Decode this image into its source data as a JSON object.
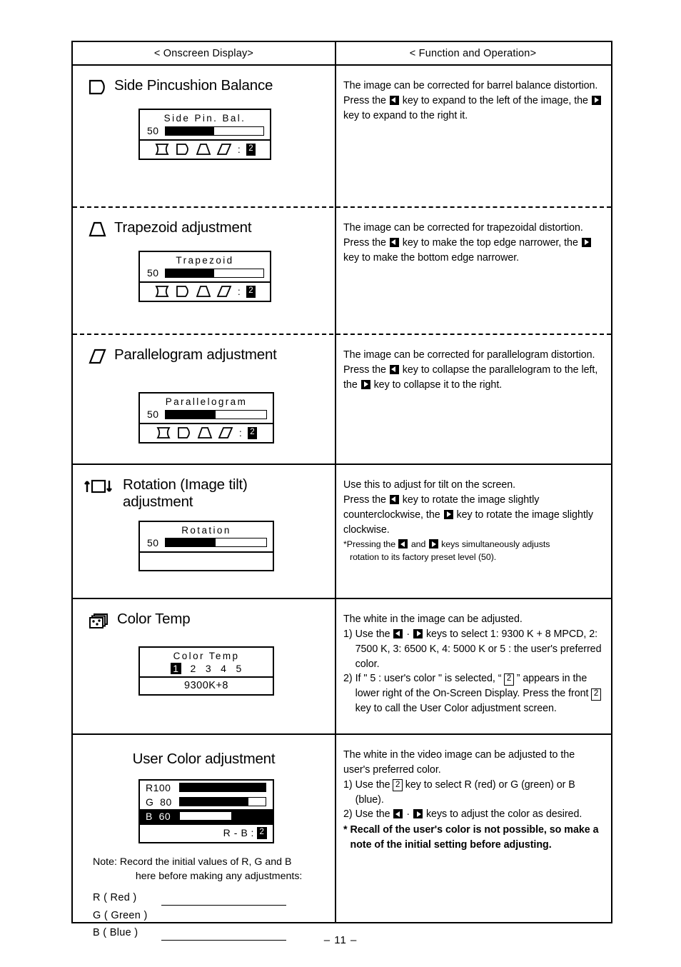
{
  "page": {
    "number_label": "– 11 –"
  },
  "table": {
    "headers": {
      "left": "< Onscreen Display>",
      "right": "< Function and Operation>"
    }
  },
  "sections": [
    {
      "id": "side-pincushion-balance",
      "icon": "side-pincushion-balance-icon",
      "title": "Side Pincushion Balance",
      "osd": {
        "label": "Side Pin. Bal.",
        "value": "50",
        "bar_fill_percent": 50,
        "shapes": [
          "pincushion-shape",
          "side-pin-balance-shape",
          "trapezoid-shape",
          "parallelogram-shape"
        ],
        "colon": ":",
        "key": "2"
      },
      "body": [
        "The image can be corrected for barrel balance distortion. Press the [LEFT] key to expand to the left of the image, the [RIGHT] key to expand to the right it."
      ]
    },
    {
      "id": "trapezoid-adjustment",
      "icon": "trapezoid-icon",
      "title": "Trapezoid  adjustment",
      "osd": {
        "label": "Trapezoid",
        "value": "50",
        "bar_fill_percent": 50,
        "shapes": [
          "pincushion-shape",
          "side-pin-balance-shape",
          "trapezoid-shape",
          "parallelogram-shape"
        ],
        "colon": ":",
        "key": "2"
      },
      "body": [
        "The image can be corrected for trapezoidal distortion.",
        "Press the [LEFT] key to make the top edge narrower, the [RIGHT] key to make the bottom edge narrower."
      ]
    },
    {
      "id": "parallelogram-adjustment",
      "icon": "parallelogram-icon",
      "title": "Parallelogram  adjustment",
      "osd": {
        "label": "Parallelogram",
        "value": "50",
        "bar_fill_percent": 50,
        "shapes": [
          "pincushion-shape",
          "side-pin-balance-shape",
          "trapezoid-shape",
          "parallelogram-shape"
        ],
        "colon": ":",
        "key": "2"
      },
      "body": [
        "The image can be corrected for parallelogram distortion.",
        "Press the [LEFT] key to collapse the parallelogram to the left, the [RIGHT] key to collapse it to the right."
      ]
    },
    {
      "id": "rotation-adjustment",
      "icon": "rotation-image-tilt-icon",
      "title": "Rotation (Image tilt)\n  adjustment",
      "osd": {
        "label": "Rotation",
        "value": "50",
        "bar_fill_percent": 50
      },
      "body": [
        "Use this to adjust for tilt on the screen.",
        "Press the [LEFT] key to rotate the image slightly counterclockwise, the [RIGHT] key to rotate the image slightly clockwise."
      ],
      "footnote": "*Pressing the [LEFT] and [RIGHT] keys simultaneously adjusts rotation to its factory preset level (50)."
    },
    {
      "id": "color-temp",
      "icon": "color-temp-icon",
      "title": "Color Temp",
      "osd": {
        "label": "Color Temp",
        "options": [
          "1",
          "2",
          "3",
          "4",
          "5"
        ],
        "selected_index": 0,
        "value_text": "9300K+8"
      },
      "body_intro": "The white in the image can be adjusted.",
      "body_items": [
        {
          "marker": "1)",
          "text": "Use the [LEFT] · [RIGHT] keys to select 1: 9300 K + 8 MPCD, 2: 7500 K, 3: 6500 K, 4: 5000 K  or 5 : the user's preferred color."
        },
        {
          "marker": "2)",
          "text": "If \" 5 : user's color \" is selected, \" [KEY2] \" appears in the lower right of the On-Screen Display. Press the front [KEY2] key to call the User Color adjustment screen."
        }
      ]
    },
    {
      "id": "user-color-adjustment",
      "icon": null,
      "title": "User Color adjustment",
      "osd": {
        "rows": [
          {
            "key": "R100",
            "bar_fill_percent": 100,
            "inverted": false,
            "fill_side": "left"
          },
          {
            "key": "G  80",
            "bar_fill_percent": 80,
            "inverted": false,
            "fill_side": "left"
          },
          {
            "key": "B  60",
            "bar_fill_percent": 40,
            "inverted": true,
            "fill_side": "right"
          }
        ],
        "footer_text": "R - B",
        "footer_colon": ":",
        "footer_key": "2"
      },
      "body_intro": "The white in the video image can be adjusted to the user's preferred color.",
      "body_items": [
        {
          "marker": "1)",
          "text": "Use the [KEY2] key to select R (red) or G (green) or B (blue)."
        },
        {
          "marker": "2)",
          "text": "Use the [LEFT] · [RIGHT] keys to adjust the color as desired."
        }
      ],
      "body_bold": {
        "marker": "*",
        "text": "Recall of the user's color is not possible, so make a note of the initial setting before adjusting."
      },
      "note": {
        "label": "Note:",
        "text": "Record the initial values of R, G and B here before making any adjustments:",
        "fields": [
          "R ( Red )",
          "G ( Green )",
          "B ( Blue )"
        ]
      }
    }
  ]
}
